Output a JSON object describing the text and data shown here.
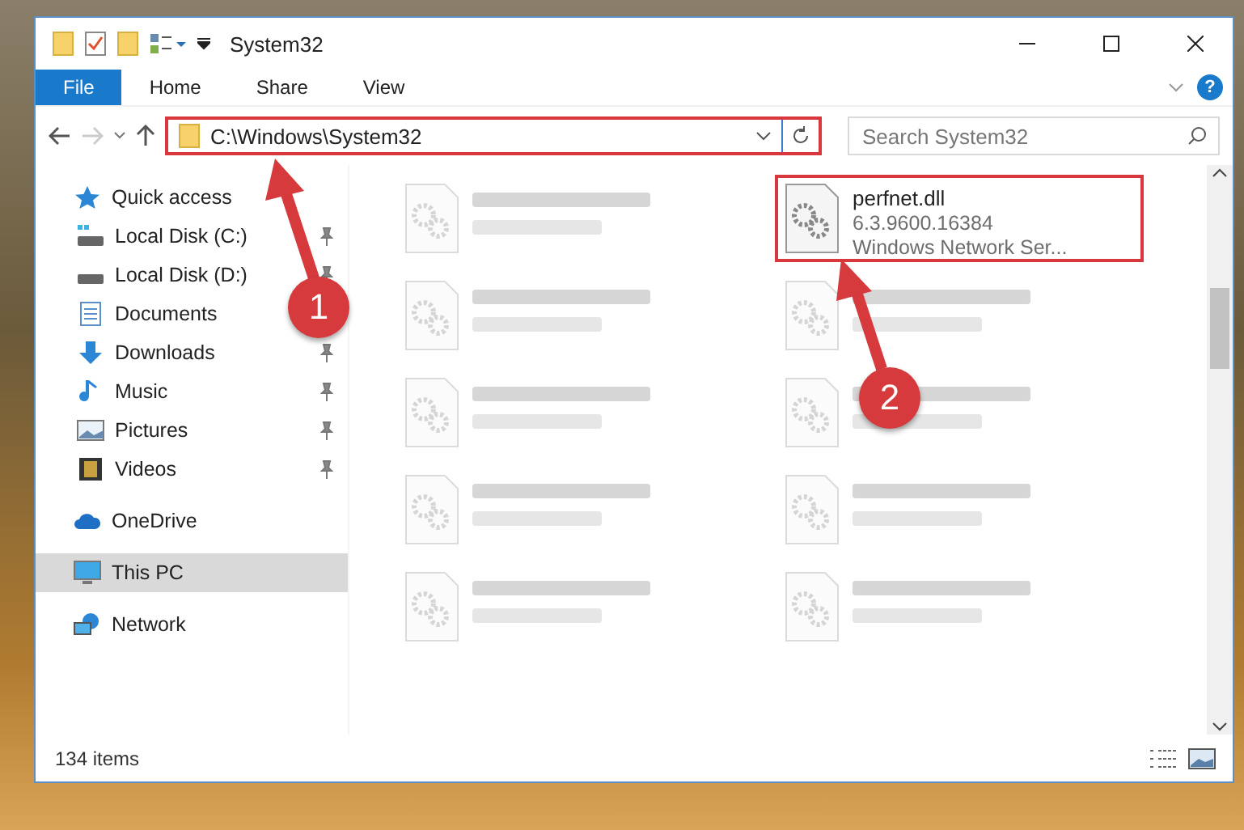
{
  "window": {
    "title": "System32"
  },
  "ribbon": {
    "tabs": [
      {
        "label": "File",
        "selected": true
      },
      {
        "label": "Home",
        "selected": false
      },
      {
        "label": "Share",
        "selected": false
      },
      {
        "label": "View",
        "selected": false
      }
    ],
    "help": "?"
  },
  "address_bar": {
    "path": "C:\\Windows\\System32",
    "highlighted": true
  },
  "search": {
    "placeholder": "Search System32"
  },
  "sidebar": {
    "items": [
      {
        "label": "Quick access",
        "kind": "star",
        "selected": false,
        "children": [
          {
            "label": "Local Disk (C:)",
            "kind": "drive-c",
            "pinned": true
          },
          {
            "label": "Local Disk (D:)",
            "kind": "drive",
            "pinned": true
          },
          {
            "label": "Documents",
            "kind": "document"
          },
          {
            "label": "Downloads",
            "kind": "download",
            "pinned": true
          },
          {
            "label": "Music",
            "kind": "music",
            "pinned": true
          },
          {
            "label": "Pictures",
            "kind": "picture",
            "pinned": true
          },
          {
            "label": "Videos",
            "kind": "video",
            "pinned": true
          }
        ]
      },
      {
        "label": "OneDrive",
        "kind": "cloud",
        "selected": false
      },
      {
        "label": "This PC",
        "kind": "pc",
        "selected": true
      },
      {
        "label": "Network",
        "kind": "network",
        "selected": false
      }
    ]
  },
  "files": [
    {
      "kind": "blurred"
    },
    {
      "kind": "file",
      "name": "perfnet.dll",
      "line_2": "6.3.9600.16384",
      "line_3": "Windows Network Ser...",
      "highlighted": true
    },
    {
      "kind": "blurred"
    },
    {
      "kind": "blurred"
    },
    {
      "kind": "blurred"
    },
    {
      "kind": "blurred"
    },
    {
      "kind": "blurred"
    },
    {
      "kind": "blurred"
    },
    {
      "kind": "blurred"
    },
    {
      "kind": "blurred"
    }
  ],
  "status_bar": {
    "item_count": "134 items"
  },
  "annotations": [
    {
      "label": "1"
    },
    {
      "label": "2"
    }
  ]
}
